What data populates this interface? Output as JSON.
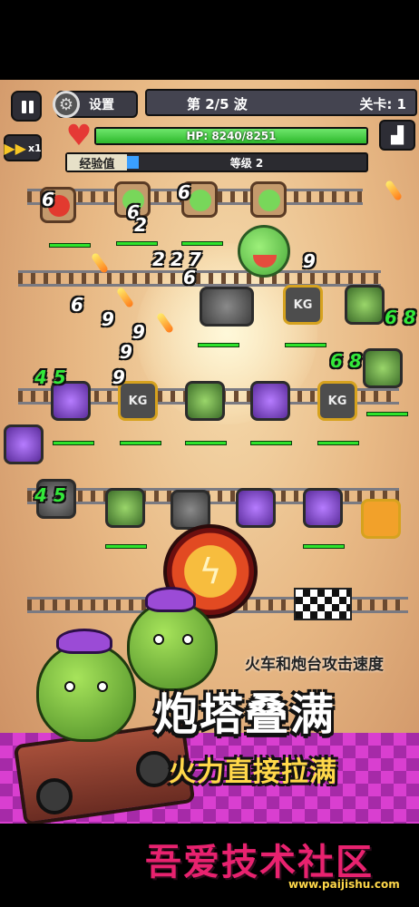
{
  "hud": {
    "settings_label": "设置",
    "wave_text": "第 2/5 波",
    "level_text": "关卡: 1",
    "speed_label": "x1",
    "hp_text": "HP: 8240/8251",
    "hp_fraction": 0.9987,
    "exp_label": "经验值",
    "exp_level_text": "等级 2",
    "exp_fraction": 0.05
  },
  "damage_numbers": [
    "6",
    "6",
    "2",
    "6",
    "2",
    "2",
    "7",
    "9",
    "6",
    "6",
    "9",
    "9",
    "9",
    "9",
    "6 8",
    "4 5",
    "6 8",
    "4 5"
  ],
  "towers": {
    "kg_label": "KG"
  },
  "tip_text": "火车和炮台攻击速度",
  "promo": {
    "title": "炮塔叠满",
    "subtitle": "火力直接拉满"
  },
  "watermark": {
    "title": "吾爱技术社区",
    "url": "www.paijishu.com"
  },
  "colors": {
    "hp_green": "#2db82b",
    "exp_blue": "#3aa0ff",
    "promo_magenta": "#d93fd0",
    "watermark_pink": "#e8226f"
  }
}
